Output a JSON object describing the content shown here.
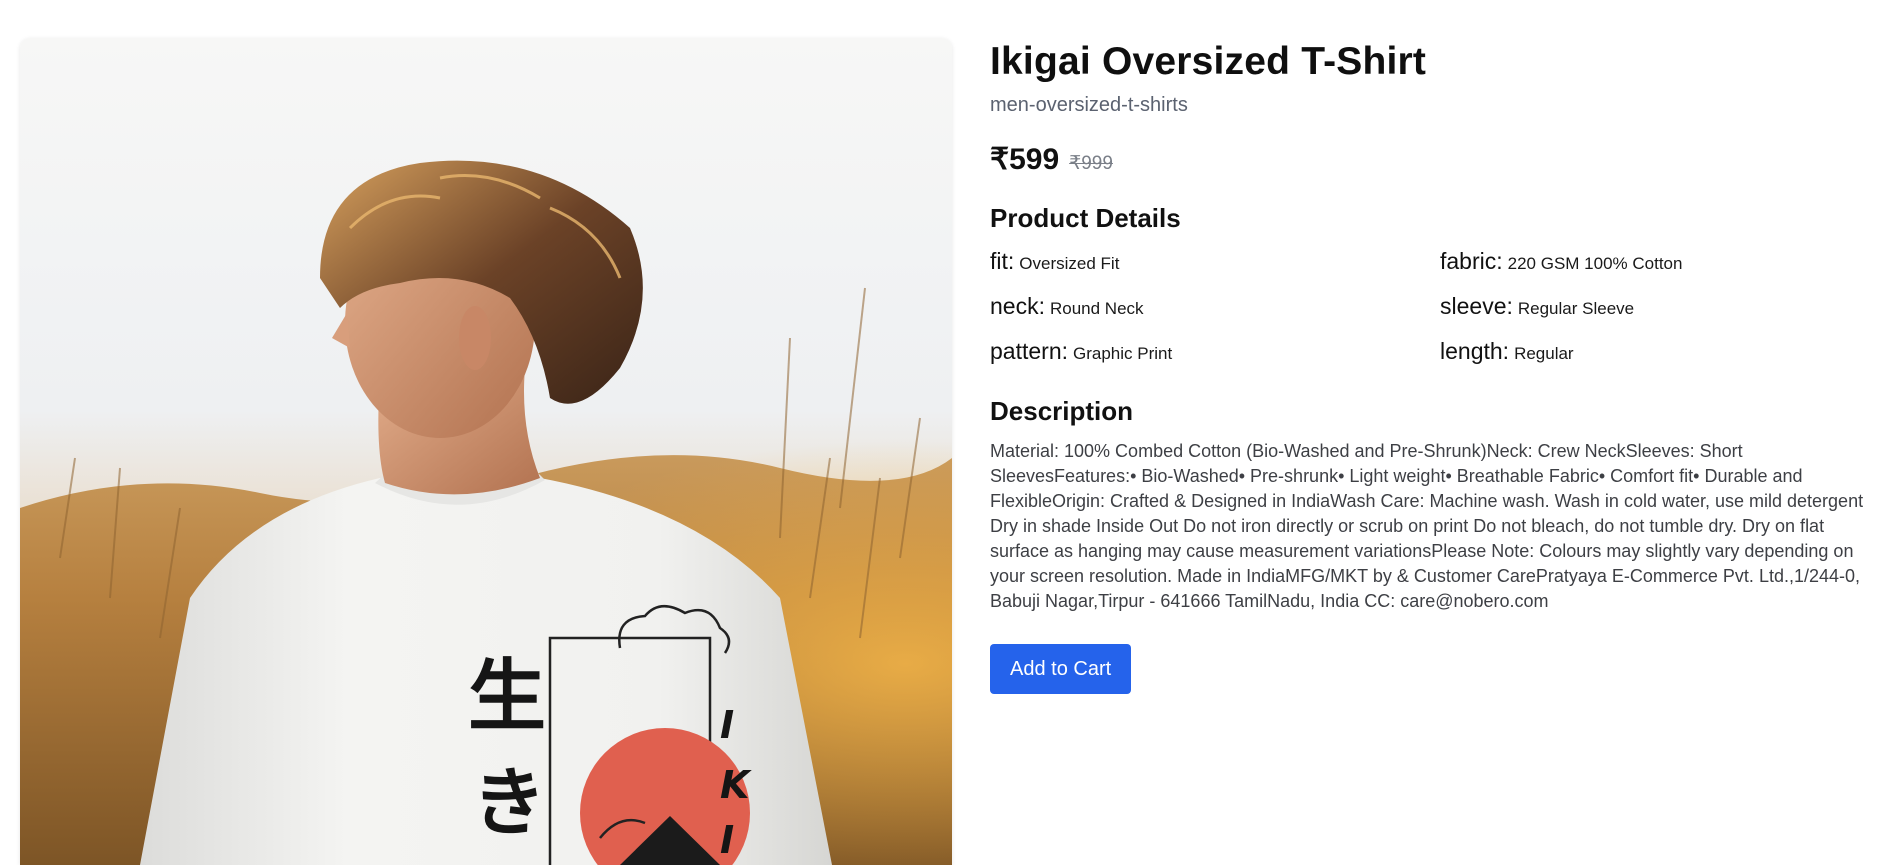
{
  "product": {
    "title": "Ikigai Oversized T-Shirt",
    "category": "men-oversized-t-shirts",
    "price": "₹599",
    "mrp": "₹999",
    "image_alt": "Man wearing white oversized t-shirt with Ikigai back print in a golden field"
  },
  "details": {
    "heading": "Product Details",
    "items": [
      {
        "key": "fit:",
        "value": "Oversized Fit"
      },
      {
        "key": "fabric:",
        "value": "220 GSM 100% Cotton"
      },
      {
        "key": "neck:",
        "value": "Round Neck"
      },
      {
        "key": "sleeve:",
        "value": "Regular Sleeve"
      },
      {
        "key": "pattern:",
        "value": "Graphic Print"
      },
      {
        "key": "length:",
        "value": "Regular"
      }
    ]
  },
  "description": {
    "heading": "Description",
    "text": "Material: 100% Combed Cotton (Bio-Washed and Pre-Shrunk)Neck: Crew NeckSleeves: Short SleevesFeatures:• Bio-Washed• Pre-shrunk• Light weight• Breathable Fabric• Comfort fit• Durable and FlexibleOrigin: Crafted & Designed in IndiaWash Care: Machine wash. Wash in cold water, use mild detergent Dry in shade Inside Out Do not iron directly or scrub on print Do not bleach, do not tumble dry. Dry on flat surface as hanging may cause measurement variationsPlease Note: Colours may slightly vary depending on your screen resolution. Made in IndiaMFG/MKT by & Customer CarePratyaya E-Commerce Pvt. Ltd.,1/244-0, Babuji Nagar,Tirpur - 641666 TamilNadu, India CC: care@nobero.com"
  },
  "actions": {
    "add_to_cart": "Add to Cart"
  },
  "print": {
    "kanji_top": "生",
    "kanji_bottom": "き",
    "letter_1": "I",
    "letter_2": "K",
    "letter_3": "I"
  },
  "colors": {
    "accent": "#2563eb",
    "sun": "#e0604f",
    "shirt": "#f1f1ef"
  }
}
